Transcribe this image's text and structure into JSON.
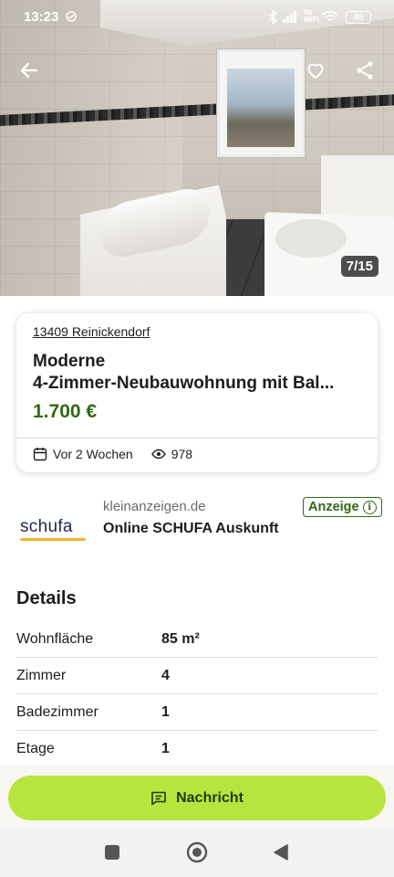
{
  "status_bar": {
    "time": "13:23",
    "vowifi_top": "Vo",
    "vowifi_bottom": "WiFi",
    "battery": "45"
  },
  "hero": {
    "image_counter": "7/15"
  },
  "listing": {
    "location": "13409 Reinickendorf",
    "title_line1": "Moderne",
    "title_line2": "4-Zimmer-Neubauwohnung mit Bal...",
    "price": "1.700 €",
    "posted": "Vor 2 Wochen",
    "views": "978",
    "price_color": "#326916"
  },
  "ad": {
    "logo_text": "schufa",
    "domain": "kleinanzeigen.de",
    "title": "Online SCHUFA Auskunft",
    "badge": "Anzeige",
    "badge_icon": "i"
  },
  "details": {
    "title": "Details",
    "rows": [
      {
        "label": "Wohnfläche",
        "value": "85 m²"
      },
      {
        "label": "Zimmer",
        "value": "4"
      },
      {
        "label": "Badezimmer",
        "value": "1"
      },
      {
        "label": "Etage",
        "value": "1"
      }
    ]
  },
  "cta": {
    "label": "Nachricht",
    "color": "#b7e53d"
  },
  "icons": {
    "back": "arrow-left-icon",
    "favorite": "heart-icon",
    "share": "share-icon",
    "calendar": "calendar-icon",
    "eye": "eye-icon",
    "message": "message-icon",
    "nav_recents": "square-icon",
    "nav_home": "circle-icon",
    "nav_back": "triangle-back-icon"
  }
}
